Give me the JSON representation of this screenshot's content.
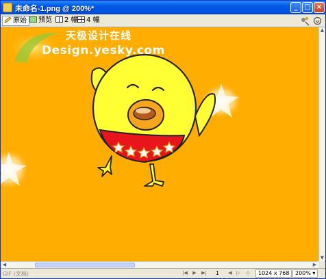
{
  "window": {
    "title": "未命名-1.png @ 200%*",
    "minimize": "_",
    "maximize": "□",
    "close": "×"
  },
  "toolbar": {
    "tabs": [
      {
        "label": "原始",
        "icon": "pencil-icon"
      },
      {
        "label": "预览",
        "icon": "preview-icon"
      },
      {
        "label": "2 幅",
        "icon": "two-up-icon"
      },
      {
        "label": "4 幅",
        "icon": "four-up-icon"
      }
    ]
  },
  "canvas": {
    "background": "#ffad00",
    "watermark_cn": "天极设计在线",
    "watermark_en": "Design.yesky.com"
  },
  "statusbar": {
    "format": "GIF (文档)",
    "frame": "1",
    "doc_size": "1024 x 768",
    "zoom": "200%"
  },
  "colors": {
    "chick_body": "#ffff33",
    "belt": "#e8151b",
    "beak": "#f7a51a"
  }
}
